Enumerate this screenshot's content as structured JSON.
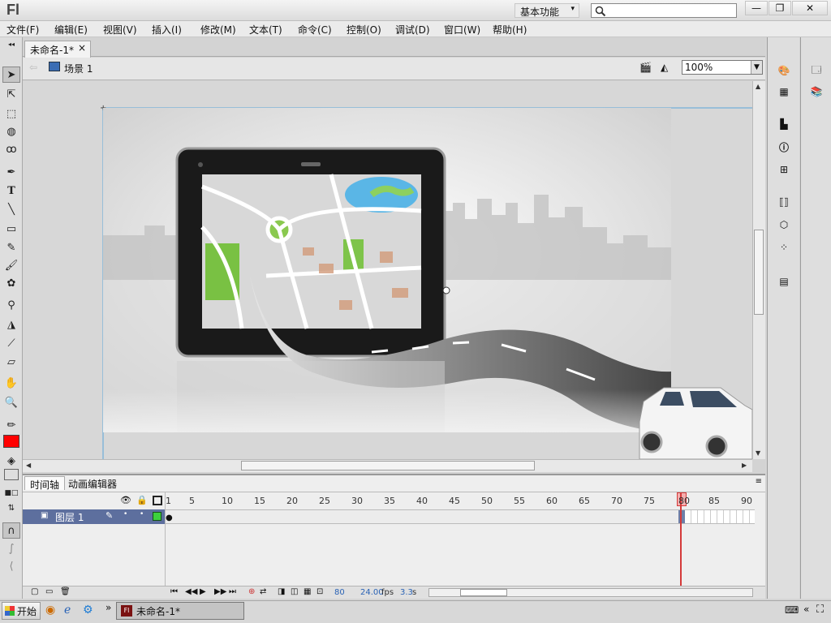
{
  "app": {
    "logo": "Fl",
    "workspace": "基本功能",
    "search_placeholder": "",
    "win_minimize": "—",
    "win_restore": "❐",
    "win_close": "✕"
  },
  "menu": [
    "文件(F)",
    "编辑(E)",
    "视图(V)",
    "插入(I)",
    "修改(M)",
    "文本(T)",
    "命令(C)",
    "控制(O)",
    "调试(D)",
    "窗口(W)",
    "帮助(H)"
  ],
  "document": {
    "tab_label": "未命名-1*",
    "tab_close": "×",
    "scene_label": "场景 1",
    "zoom": "100%"
  },
  "timeline": {
    "tab_timeline": "时间轴",
    "tab_motion": "动画编辑器",
    "ruler": [
      "1",
      "5",
      "10",
      "15",
      "20",
      "25",
      "30",
      "35",
      "40",
      "45",
      "50",
      "55",
      "60",
      "65",
      "70",
      "75",
      "80",
      "85",
      "90"
    ],
    "layer_name": "图层 1",
    "current_frame": "80",
    "fps": "24.00",
    "fps_unit": "fps",
    "elapsed": "3.3",
    "elapsed_unit": "s"
  },
  "taskbar": {
    "start": "开始",
    "task_item": "未命名-1*",
    "more": "»",
    "tray_expand": "«"
  },
  "colors": {
    "stroke_color": "#000000",
    "fill_color": "#ff0000",
    "layer_row": "#5d6f9e",
    "playhead": "#d43a3a",
    "stage_border": "#58a6d8"
  }
}
